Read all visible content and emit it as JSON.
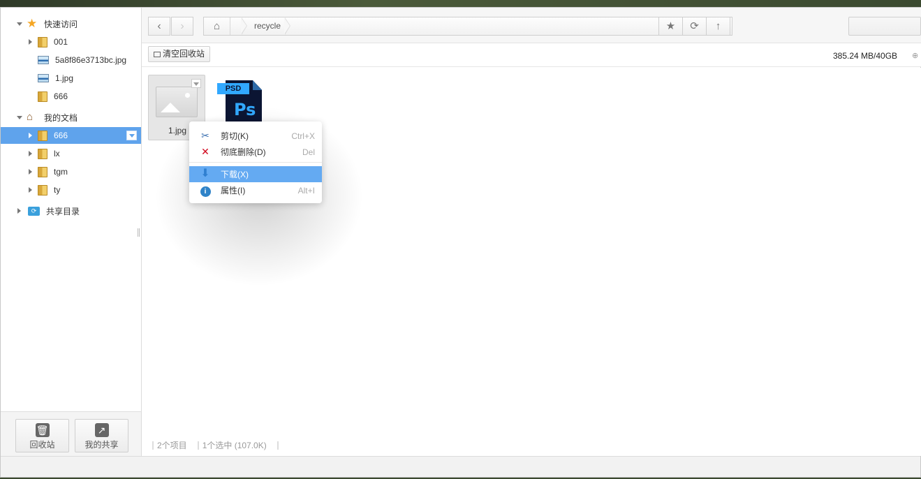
{
  "sidebar": {
    "quick_access": "快速访问",
    "items": [
      {
        "label": "001"
      },
      {
        "label": "5a8f86e3713bc.jpg"
      },
      {
        "label": "1.jpg"
      },
      {
        "label": "666"
      }
    ],
    "my_docs": "我的文档",
    "doc_items": [
      {
        "label": "666"
      },
      {
        "label": "lx"
      },
      {
        "label": "tgm"
      },
      {
        "label": "ty"
      }
    ],
    "shared": "共享目录",
    "recycle_btn": "回收站",
    "myshare_btn": "我的共享"
  },
  "toolbar": {
    "path_segment": "recycle"
  },
  "subbar": {
    "clear_label": "清空回收站",
    "quota": "385.24 MB/40GB"
  },
  "files": [
    {
      "name": "1.jpg"
    }
  ],
  "psd_tag": "PSD",
  "psd_mark": "Ps",
  "status": {
    "count": "2个项目",
    "selected": "1个选中 (107.0K)"
  },
  "context_menu": {
    "items": [
      {
        "label": "剪切(K)",
        "shortcut": "Ctrl+X"
      },
      {
        "label": "彻底删除(D)",
        "shortcut": "Del"
      },
      {
        "label": "下载(X)",
        "shortcut": ""
      },
      {
        "label": "属性(I)",
        "shortcut": "Alt+I"
      }
    ]
  },
  "colors": {
    "selection": "#5fa3ec",
    "menu_highlight": "#64aaf2"
  }
}
